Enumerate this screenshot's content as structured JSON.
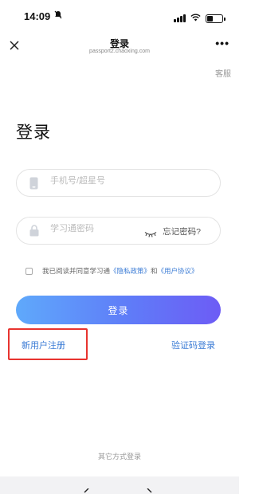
{
  "status_bar": {
    "time": "14:09"
  },
  "header": {
    "title": "登录",
    "subtitle": "passport2.chaoxing.com"
  },
  "service_link": "客服",
  "page_title": "登录",
  "phone_field": {
    "placeholder": "手机号/超星号",
    "value": ""
  },
  "password_field": {
    "placeholder": "学习通密码",
    "value": ""
  },
  "forgot_password": "忘记密码?",
  "agreement": {
    "prefix": "我已阅读并同意学习通",
    "privacy_policy": "《隐私政策》",
    "conjunction": "和",
    "user_agreement": "《用户协议》"
  },
  "login_button": "登录",
  "register_link": "新用户注册",
  "sms_login_link": "验证码登录",
  "other_login": "其它方式登录",
  "colors": {
    "accent": "#3a7bd5",
    "button_gradient_start": "#5fa9fb",
    "button_gradient_end": "#6d5cf5",
    "highlight": "#e8342f"
  }
}
